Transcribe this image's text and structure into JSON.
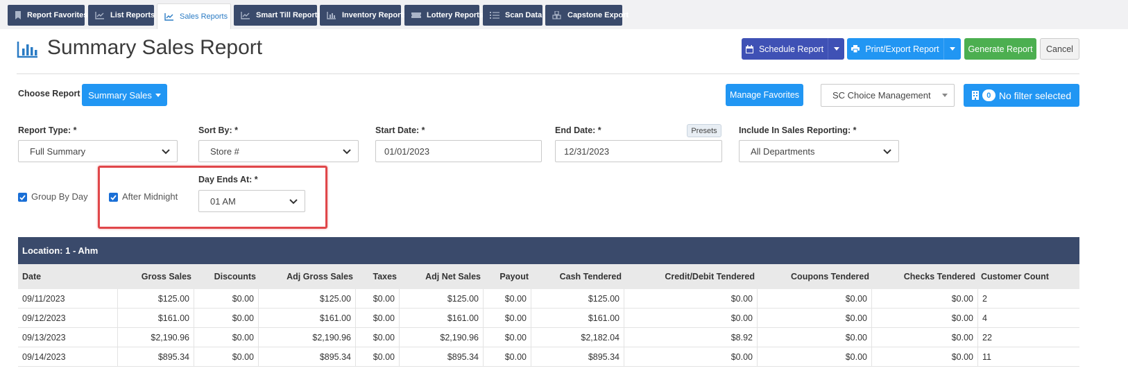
{
  "tabs": [
    {
      "label": "Report Favorites",
      "icon": "bookmark-icon"
    },
    {
      "label": "List Reports",
      "icon": "line-chart-icon"
    },
    {
      "label": "Sales Reports",
      "icon": "line-chart-icon"
    },
    {
      "label": "Smart Till Reports",
      "icon": "line-chart-icon"
    },
    {
      "label": "Inventory Reports",
      "icon": "bar-chart-icon"
    },
    {
      "label": "Lottery Reports",
      "icon": "ticket-icon"
    },
    {
      "label": "Scan Data",
      "icon": "list-icon"
    },
    {
      "label": "Capstone Export",
      "icon": "cubes-icon"
    }
  ],
  "header": {
    "title": "Summary Sales Report",
    "schedule_label": "Schedule Report",
    "print_label": "Print/Export Report",
    "generate_label": "Generate Report",
    "cancel_label": "Cancel"
  },
  "choose": {
    "label": "Choose Report",
    "report_button": "Summary Sales",
    "manage_favorites": "Manage Favorites",
    "company": "SC Choice Management",
    "filter_count": "0",
    "filter_label": "No filter selected"
  },
  "form": {
    "report_type_label": "Report Type: *",
    "report_type_value": "Full Summary",
    "sort_by_label": "Sort By: *",
    "sort_by_value": "Store #",
    "start_date_label": "Start Date: *",
    "start_date_value": "01/01/2023",
    "end_date_label": "End Date: *",
    "end_date_value": "12/31/2023",
    "presets_label": "Presets",
    "include_label": "Include In Sales Reporting: *",
    "include_value": "All Departments",
    "group_by_day_label": "Group By Day",
    "after_midnight_label": "After Midnight",
    "day_ends_label": "Day Ends At: *",
    "day_ends_value": "01 AM"
  },
  "colors": {
    "navy": "#3a4a6b",
    "blue": "#2196f3",
    "indigo": "#3f51b5",
    "green": "#4caf50",
    "highlight": "#e0474a"
  },
  "table": {
    "location": "Location: 1 - Ahm",
    "columns": [
      "Date",
      "Gross Sales",
      "Discounts",
      "Adj Gross Sales",
      "Taxes",
      "Adj Net Sales",
      "Payout",
      "Cash Tendered",
      "Credit/Debit Tendered",
      "Coupons Tendered",
      "Checks Tendered",
      "Customer Count"
    ],
    "rows": [
      [
        "09/11/2023",
        "$125.00",
        "$0.00",
        "$125.00",
        "$0.00",
        "$125.00",
        "$0.00",
        "$125.00",
        "$0.00",
        "$0.00",
        "$0.00",
        "2"
      ],
      [
        "09/12/2023",
        "$161.00",
        "$0.00",
        "$161.00",
        "$0.00",
        "$161.00",
        "$0.00",
        "$161.00",
        "$0.00",
        "$0.00",
        "$0.00",
        "4"
      ],
      [
        "09/13/2023",
        "$2,190.96",
        "$0.00",
        "$2,190.96",
        "$0.00",
        "$2,190.96",
        "$0.00",
        "$2,182.04",
        "$8.92",
        "$0.00",
        "$0.00",
        "22"
      ],
      [
        "09/14/2023",
        "$895.34",
        "$0.00",
        "$895.34",
        "$0.00",
        "$895.34",
        "$0.00",
        "$895.34",
        "$0.00",
        "$0.00",
        "$0.00",
        "11"
      ]
    ]
  }
}
